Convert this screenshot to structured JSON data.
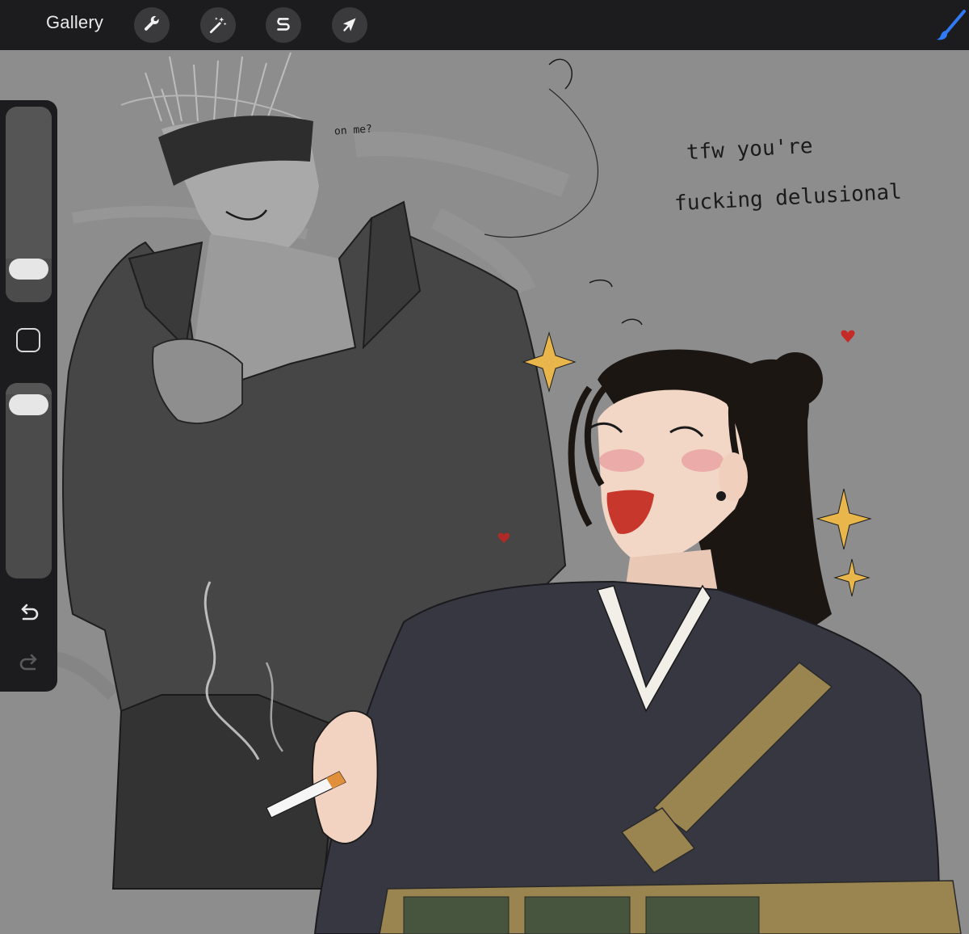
{
  "toolbar": {
    "gallery_label": "Gallery",
    "tools": [
      {
        "name": "actions",
        "icon": "wrench-icon"
      },
      {
        "name": "adjustments",
        "icon": "magic-wand-icon"
      },
      {
        "name": "selection",
        "icon": "selection-s-icon"
      },
      {
        "name": "transform",
        "icon": "arrow-cursor-icon"
      }
    ],
    "brush_icon": "paintbrush-icon",
    "accent_color": "#2f7bf6"
  },
  "sidebar": {
    "brush_size_level": 0.1,
    "opacity_level": 0.97,
    "modify_icon": "square-icon",
    "undo_icon": "undo-icon",
    "redo_icon": "redo-icon"
  },
  "canvas": {
    "text_1": "on me?",
    "text_2_line1": "tfw you're",
    "text_2_line2": "fucking delusional",
    "background_color": "#8d8d8d"
  }
}
